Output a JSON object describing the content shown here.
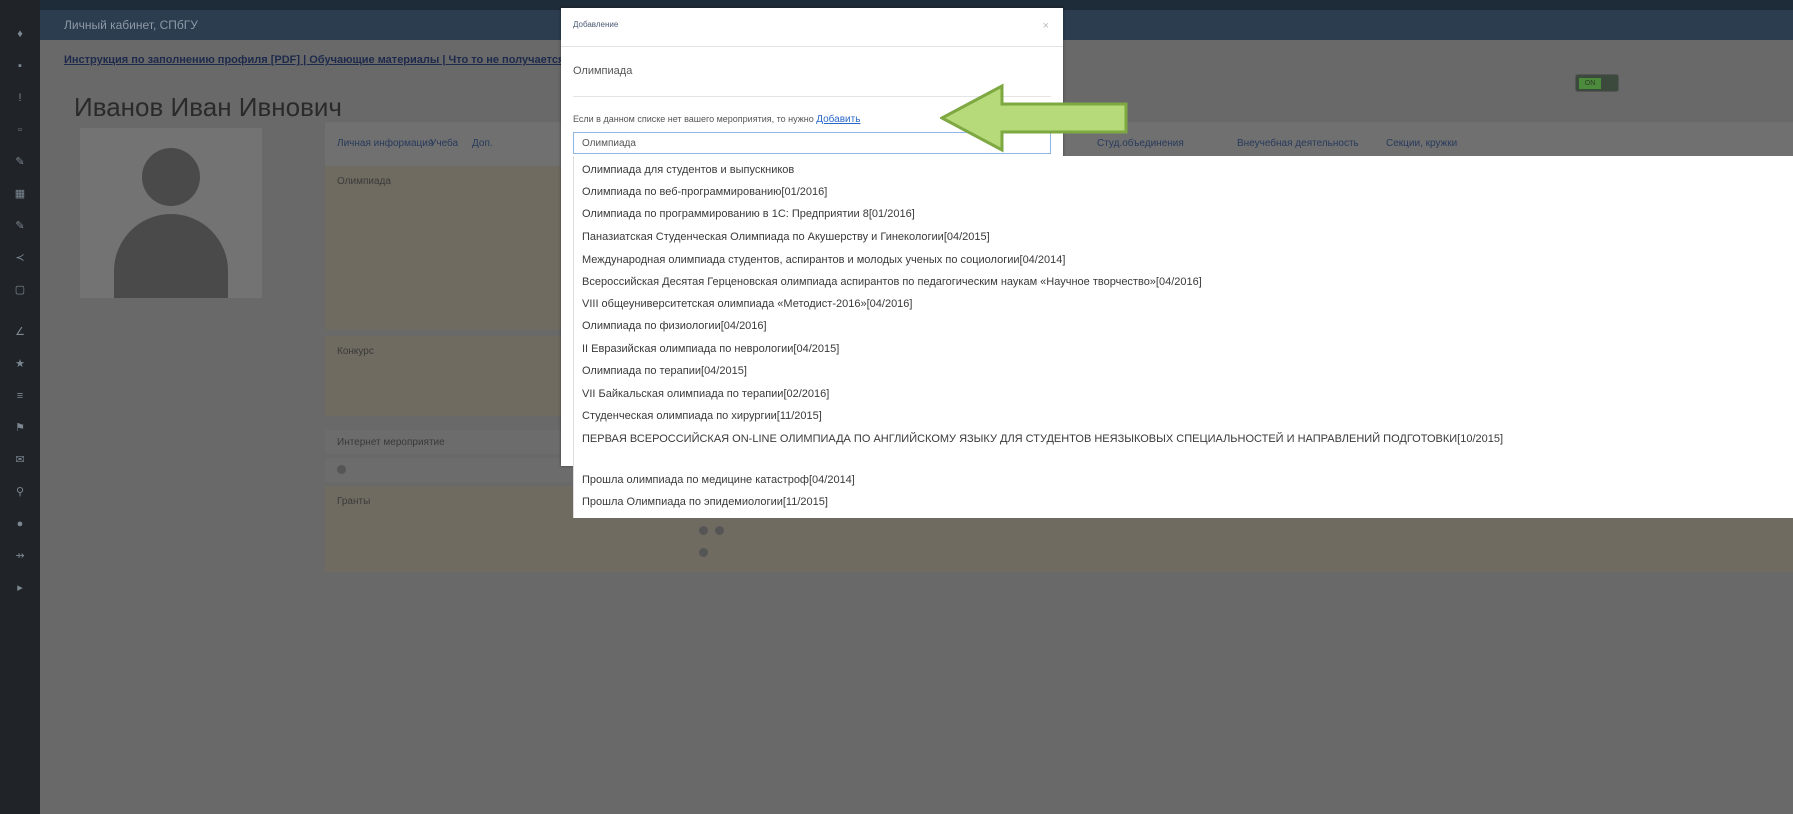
{
  "topbar": {
    "title": "Личный кабинет, СПбГУ"
  },
  "page": {
    "links": "Инструкция по заполнению профиля [PDF] | Обучающие материалы | Что то не получается?",
    "person_name": "Иванов Иван Ивнович",
    "toggle_label": "ON",
    "tabs": [
      "Личная информация",
      "Учеба",
      "Доп.",
      "Студ.объединения",
      "Внеучебная деятельность",
      "Секции, кружки"
    ],
    "panels": {
      "olympiad": "Олимпиада",
      "contest": "Конкурс",
      "events": "Интернет мероприятие",
      "grants": "Гранты"
    }
  },
  "modal": {
    "header": "Добавление",
    "close": "×",
    "event_type": "Олимпиада",
    "hint_text": "Если в данном списке нет вашего мероприятия, то нужно",
    "hint_link": "Добавить",
    "search_value": "Олимпиада"
  },
  "dropdown": {
    "options": [
      "Олимпиада для студентов и выпускников",
      "Олимпиада по веб-программированию[01/2016]",
      "Олимпиада по программированию в 1С: Предприятии 8[01/2016]",
      "Паназиатская Студенческая Олимпиада по Акушерству и Гинекологии[04/2015]",
      "Международная олимпиада студентов, аспирантов и молодых ученых по социологии[04/2014]",
      "Всероссийская Десятая Герценовская олимпиада аспирантов по педагогическим наукам «Научное творчество»[04/2016]",
      "VIII общеуниверситетская олимпиада «Методист-2016»[04/2016]",
      "Олимпиада по физиологии[04/2016]",
      "II Евразийская олимпиада по неврологии[04/2015]",
      "Олимпиада по терапии[04/2015]",
      "VII Байкальская олимпиада по терапии[02/2016]",
      "Студенческая олимпиада по хирургии[11/2015]",
      "ПЕРВАЯ ВСЕРОССИЙСКАЯ ON-LINE ОЛИМПИАДА ПО АНГЛИЙСКОМУ ЯЗЫКУ ДЛЯ СТУДЕНТОВ НЕЯЗЫКОВЫХ СПЕЦИАЛЬНОСТЕЙ И НАПРАВЛЕНИЙ ПОДГОТОВКИ[10/2015]",
      "Прошла олимпиада по медицине катастроф[04/2014]",
      "Прошла Олимпиада по эпидемиологии[11/2015]"
    ]
  },
  "icons": {
    "arrow_color": "#b6d97a",
    "arrow_stroke": "#7ea842"
  }
}
